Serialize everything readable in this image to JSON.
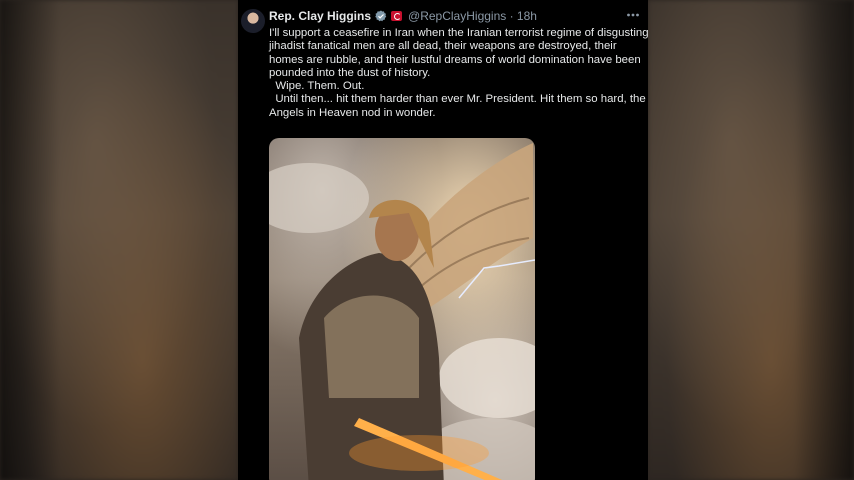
{
  "tweet": {
    "display_name": "Rep. Clay Higgins",
    "handle_time": "@RepClayHiggins · 18h",
    "lines": [
      "I'll support a ceasefire in Iran when the Iranian terrorist regime of disgusting",
      "jihadist fanatical men are all dead, their weapons are destroyed, their",
      "homes are rubble, and their lustful dreams of world domination have been",
      "pounded into the dust of history.",
      "  Wipe. Them. Out.",
      "  Until then... hit them harder than ever Mr. President. Hit them so hard, the",
      "Angels in Heaven nod in wonder."
    ]
  },
  "colors": {
    "background": "#000000",
    "text": "#e7e9ea",
    "secondary_text": "#8b98a5",
    "verified_badge": "#829aab"
  },
  "icons": {
    "verified": "verified-badge-icon",
    "flag": "flag-icon",
    "more": "more-options-icon"
  }
}
